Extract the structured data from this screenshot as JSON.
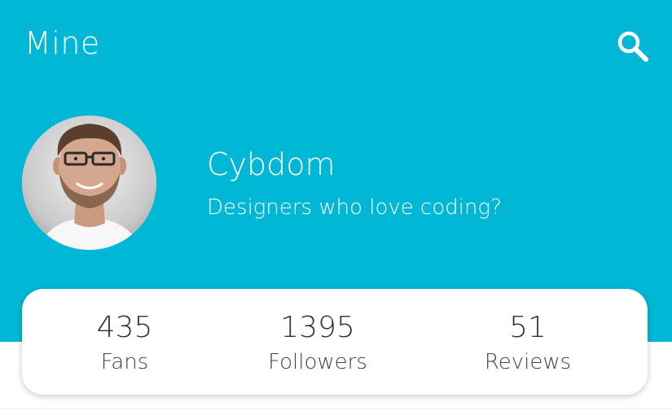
{
  "topbar": {
    "title": "Mine",
    "search_icon": "search-icon"
  },
  "profile": {
    "name": "Cybdom",
    "bio": "Designers who love coding?",
    "avatar_icon": "avatar"
  },
  "stats": [
    {
      "value": "435",
      "label": "Fans"
    },
    {
      "value": "1395",
      "label": "Followers"
    },
    {
      "value": "51",
      "label": "Reviews"
    }
  ],
  "colors": {
    "header_bg": "#00B8D6",
    "card_bg": "#FFFFFF",
    "text_on_header": "#FFFFFF",
    "stat_text": "#333333"
  }
}
